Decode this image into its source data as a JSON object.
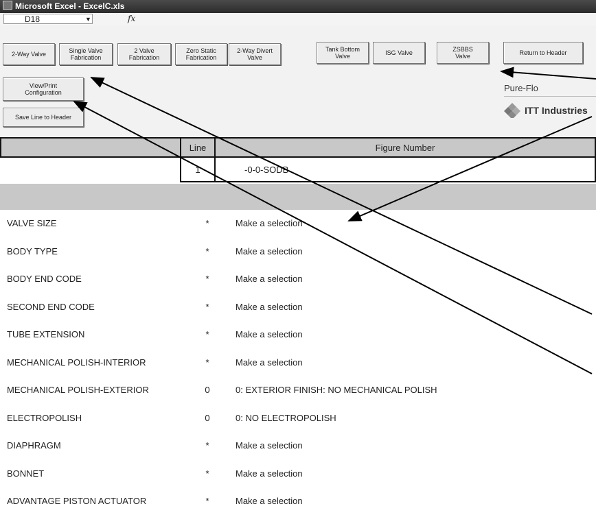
{
  "window": {
    "title": "Microsoft Excel - ExcelC.xls"
  },
  "formula_bar": {
    "cell_ref": "D18",
    "fx": "fx"
  },
  "toolbar": {
    "buttons": [
      "2-Way Valve",
      "Single Valve\nFabrication",
      "2 Valve\nFabrication",
      "Zero Static\nFabrication",
      "2-Way Divert Valve",
      "Tank Bottom\nValve",
      "ISG Valve",
      "ZSBBS\nValve",
      "Return to Header"
    ],
    "view_print": "View/Print\nConfiguration",
    "save_line": "Save Line to Header"
  },
  "branding": {
    "line1": "Pure-Flo",
    "line2": "ITT Industries"
  },
  "table": {
    "col_line": "Line",
    "col_figure": "Figure Number",
    "line_value": "1",
    "figure_value": "-0-0-SODB"
  },
  "rows": [
    {
      "label": "VALVE SIZE",
      "value": "*",
      "selection": "Make a selection"
    },
    {
      "label": "BODY TYPE",
      "value": "*",
      "selection": "Make a selection"
    },
    {
      "label": "BODY END CODE",
      "value": "*",
      "selection": "Make a selection"
    },
    {
      "label": "SECOND END CODE",
      "value": "*",
      "selection": "Make a selection"
    },
    {
      "label": "TUBE EXTENSION",
      "value": "*",
      "selection": "Make a selection"
    },
    {
      "label": "MECHANICAL POLISH-INTERIOR",
      "value": "*",
      "selection": "Make a selection"
    },
    {
      "label": "MECHANICAL POLISH-EXTERIOR",
      "value": "0",
      "selection": "0: EXTERIOR FINISH: NO MECHANICAL POLISH"
    },
    {
      "label": "ELECTROPOLISH",
      "value": "0",
      "selection": "0: NO ELECTROPOLISH"
    },
    {
      "label": "DIAPHRAGM",
      "value": "*",
      "selection": "Make a selection"
    },
    {
      "label": "BONNET",
      "value": "*",
      "selection": "Make a selection"
    },
    {
      "label": "ADVANTAGE PISTON ACTUATOR",
      "value": "*",
      "selection": "Make a selection"
    }
  ]
}
